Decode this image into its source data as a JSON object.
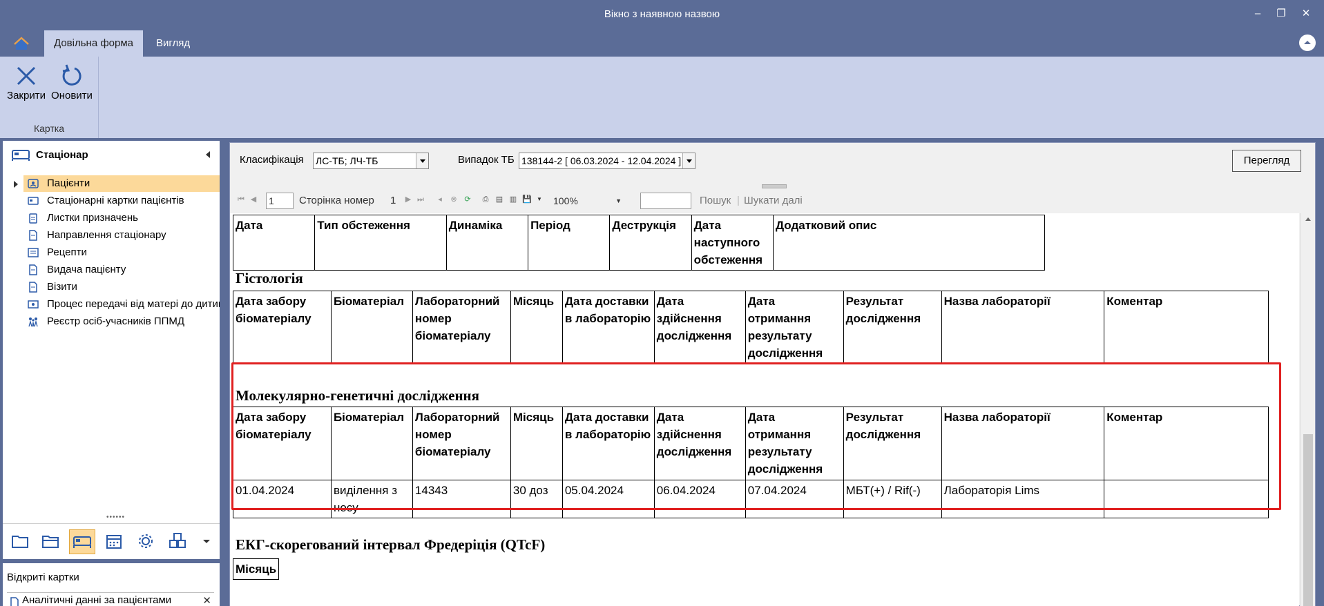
{
  "window": {
    "title": "Вікно з наявною назвою",
    "minimize": "–",
    "restore": "❐",
    "close": "✕"
  },
  "ribbon_tabs": [
    {
      "label": "Довільна форма",
      "active": true
    },
    {
      "label": "Вигляд",
      "active": false
    }
  ],
  "ribbon": {
    "close_label": "Закрити",
    "refresh_label": "Оновити",
    "group_label": "Картка"
  },
  "nav": {
    "header": "Стаціонар",
    "items": [
      {
        "label": "Пацієнти",
        "icon": "patient-card-icon",
        "selected": true
      },
      {
        "label": "Стаціонарні картки пацієнтів",
        "icon": "bed-card-icon"
      },
      {
        "label": "Листки призначень",
        "icon": "clipboard-icon"
      },
      {
        "label": "Направлення стаціонару",
        "icon": "document-icon"
      },
      {
        "label": "Рецепти",
        "icon": "prescription-icon"
      },
      {
        "label": "Видача пацієнту",
        "icon": "document-icon"
      },
      {
        "label": "Візити",
        "icon": "document-icon"
      },
      {
        "label": "Процес передачі від матері до дитини",
        "icon": "transfer-icon"
      },
      {
        "label": "Реєстр осіб-учасників ППМД",
        "icon": "people-icon"
      }
    ],
    "bottom_icons": [
      "folder-icon",
      "folder-open-icon",
      "bed-icon",
      "calendar-icon",
      "gear-cluster-icon",
      "cubes-icon",
      "chevron-down-icon"
    ]
  },
  "open_cards": {
    "header": "Відкриті картки",
    "items": [
      "Аналітичні данні за пацієнтами"
    ]
  },
  "filters": {
    "classification_label": "Класифікація",
    "classification_value": "ЛС-ТБ; ЛЧ-ТБ",
    "case_label": "Випадок ТБ",
    "case_value": "138144-2  [ 06.03.2024 - 12.04.2024 ]",
    "view_button": "Перегляд"
  },
  "report_toolbar": {
    "page_input": "1",
    "page_label": "Сторінка номер",
    "page_of": "1",
    "zoom": "100%",
    "search_value": "",
    "search_label": "Пошук",
    "find_next_label": "Шукати далі"
  },
  "report": {
    "exam_headers": [
      "Дата",
      "Тип обстеження",
      "Динаміка",
      "Період",
      "Деструкція",
      "Дата наступного обстеження",
      "Додатковий опис"
    ],
    "histology": {
      "title": "Гістологія",
      "headers": [
        "Дата забору біоматеріалу",
        "Біоматеріал",
        "Лабораторний номер біоматеріалу",
        "Місяць",
        "Дата доставки в лабораторію",
        "Дата здійснення дослідження",
        "Дата отримання результату дослідження",
        "Результат дослідження",
        "Назва лабораторії",
        "Коментар"
      ]
    },
    "molecular": {
      "title": "Молекулярно-генетичні дослідження",
      "headers": [
        "Дата забору біоматеріалу",
        "Біоматеріал",
        "Лабораторний номер біоматеріалу",
        "Місяць",
        "Дата доставки в лабораторію",
        "Дата здійснення дослідження",
        "Дата отримання результату дослідження",
        "Результат дослідження",
        "Назва лабораторії",
        "Коментар"
      ],
      "row": [
        "01.04.2024",
        "виділення з носу",
        "14343",
        "30 доз",
        "05.04.2024",
        "06.04.2024",
        "07.04.2024",
        "МБТ(+) / Rif(-)",
        "Лабораторія Lims",
        ""
      ]
    },
    "ecg": {
      "title": "ЕКГ-скорегований інтервал Фредеріція (QTcF)",
      "headers": [
        "Місяць"
      ]
    }
  },
  "colors": {
    "frame": "#5b6c97",
    "ribbon": "#c9d1ea",
    "selection": "#fcd99a",
    "highlight_border": "#e02020"
  }
}
